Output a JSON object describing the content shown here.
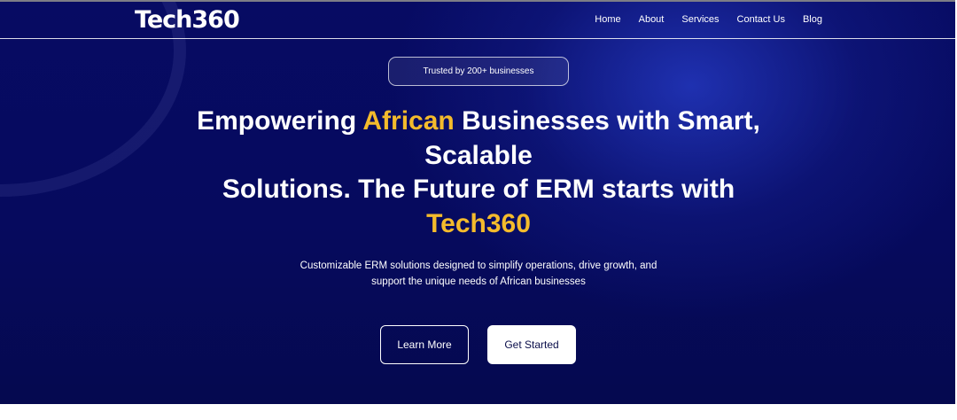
{
  "header": {
    "logo": "Tech360",
    "nav": [
      "Home",
      "About",
      "Services",
      "Contact Us",
      "Blog"
    ]
  },
  "hero": {
    "badge": "Trusted by 200+ businesses",
    "headline": {
      "part1": "Empowering ",
      "accent1": "African",
      "part2": " Businesses with Smart, Scalable",
      "part3": "Solutions. The Future of ERM starts with",
      "accent2": "Tech360"
    },
    "subtitle_line1": "Customizable ERM solutions designed to simplify operations, drive growth, and",
    "subtitle_line2": "support the unique needs of African businesses",
    "buttons": {
      "learn_more": "Learn More",
      "get_started": "Get Started"
    }
  },
  "colors": {
    "background": "#070b63",
    "accent": "#f4bb2c",
    "text": "#ffffff"
  }
}
